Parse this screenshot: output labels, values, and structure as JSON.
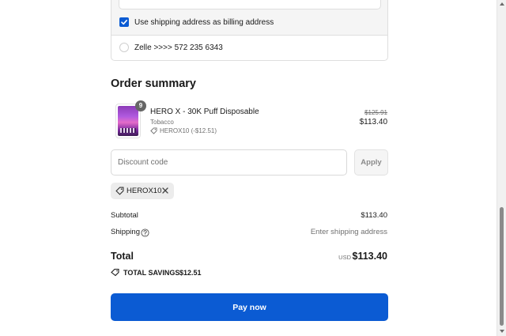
{
  "payment": {
    "billing_same_label": "Use shipping address as billing address",
    "billing_same_checked": true,
    "zelle_label": "Zelle >>>> 572 235 6343"
  },
  "order_summary": {
    "title": "Order summary",
    "item": {
      "quantity": "9",
      "name": "HERO X - 30K Puff Disposable",
      "variant": "Tobacco",
      "discount": "HEROX10 (-$12.51)",
      "original_price": "$125.91",
      "price": "$113.40"
    },
    "discount_code": {
      "placeholder": "Discount code",
      "value": "",
      "apply_label": "Apply",
      "applied_code": "HEROX10"
    },
    "subtotal": {
      "label": "Subtotal",
      "value": "$113.40"
    },
    "shipping": {
      "label": "Shipping",
      "value": "Enter shipping address"
    },
    "total": {
      "label": "Total",
      "currency": "USD",
      "value": "$113.40"
    },
    "savings": {
      "label": "TOTAL SAVINGS",
      "value": "$12.51"
    },
    "pay_button_label": "Pay now"
  },
  "icons": [
    "checkmark-icon",
    "tag-icon",
    "close-icon",
    "help-circle-icon"
  ],
  "colors": {
    "primary": "#0b5bd3",
    "muted_text": "#707070",
    "panel_bg": "#f5f5f5"
  }
}
